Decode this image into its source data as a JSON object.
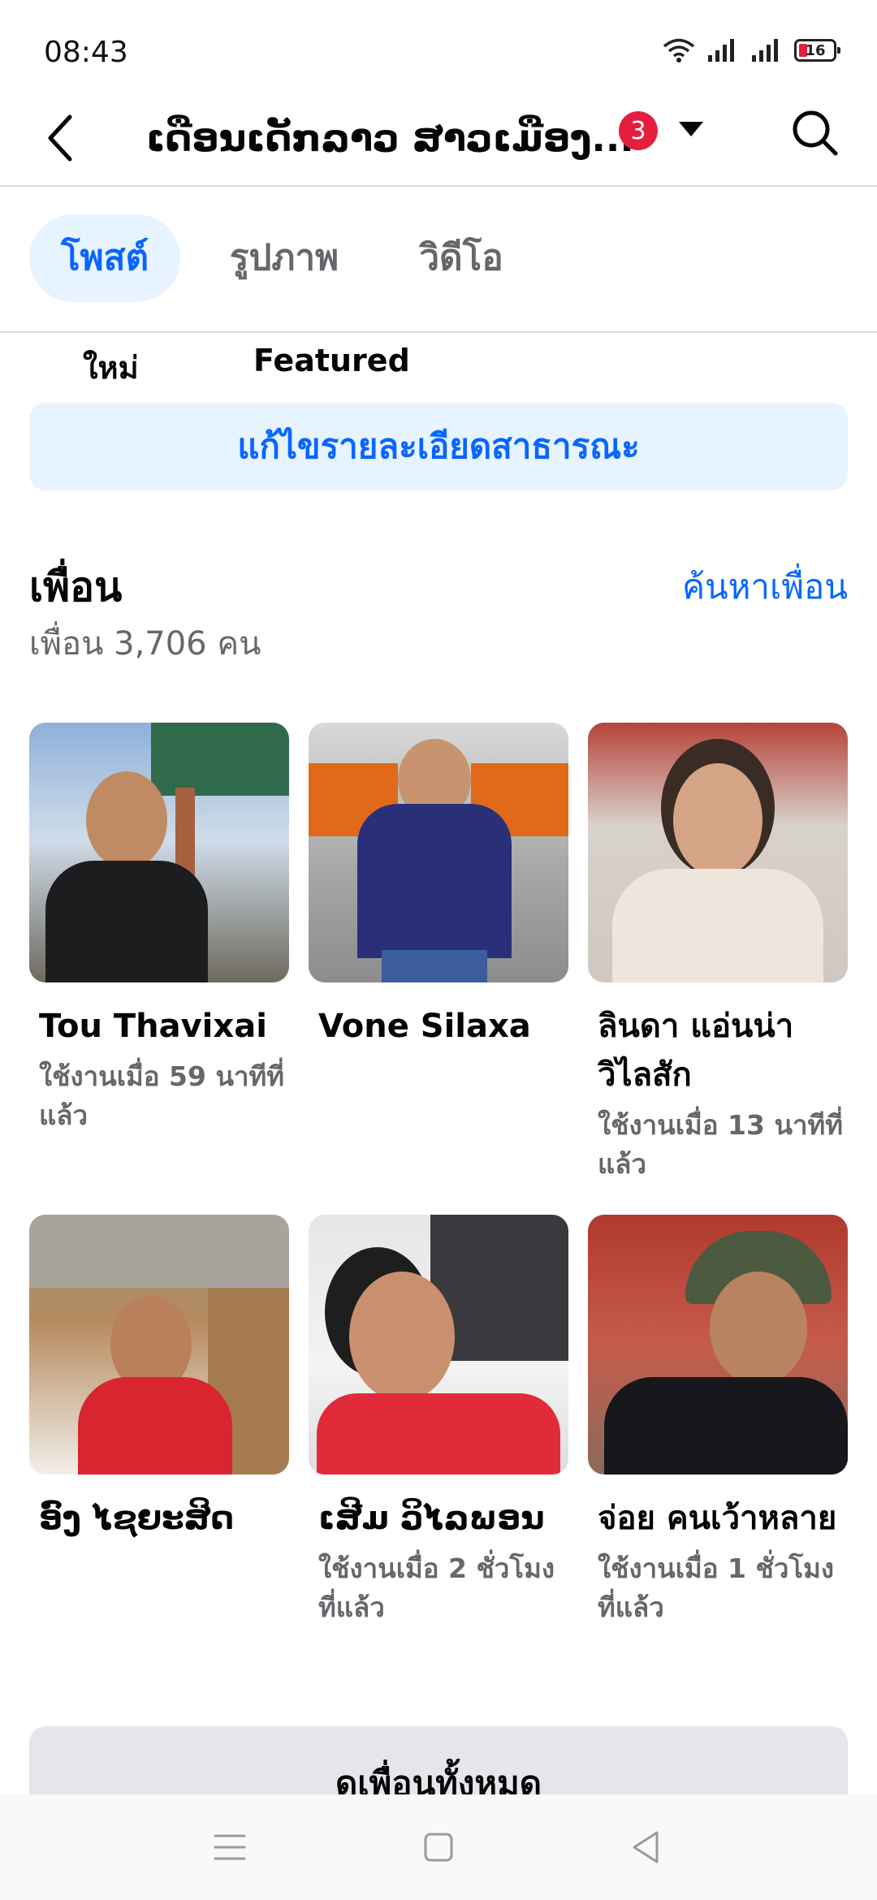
{
  "status_bar": {
    "time": "08:43",
    "battery": "16"
  },
  "header": {
    "title": "ເດືອນເດັກລາວ ສາວເມືອງ...",
    "notification_count": "3"
  },
  "tabs": [
    {
      "label": "โพสต์",
      "active": true
    },
    {
      "label": "รูปภาพ",
      "active": false
    },
    {
      "label": "วิดีโอ",
      "active": false
    }
  ],
  "sub_tabs": [
    {
      "label": "ใหม่"
    },
    {
      "label": "Featured"
    }
  ],
  "edit_public_details": "แก้ไขรายละเอียดสาธารณะ",
  "friends": {
    "title": "เพื่อน",
    "find_friends": "ค้นหาเพื่อน",
    "count": "เพื่อน 3,706 คน",
    "items": [
      {
        "name": "Tou Thavixai",
        "status": "ใช้งานเมื่อ 59 นาทีที่แล้ว"
      },
      {
        "name": "Vone Silaxa",
        "status": ""
      },
      {
        "name": "ลินดา แอ่นน่า วิไลสัก",
        "status": "ใช้งานเมื่อ 13 นาทีที่แล้ว"
      },
      {
        "name": "ອົງ ໄຊຍະສິດ",
        "status": ""
      },
      {
        "name": "ເສີມ ວິໄລພອນ",
        "status": "ใช้งานเมื่อ 2 ชั่วโมงที่แล้ว"
      },
      {
        "name": "จ่อย คนเว้าหลาย",
        "status": "ใช้งานเมื่อ 1 ชั่วโมงที่แล้ว"
      }
    ],
    "see_all": "ดูเพื่อนทั้งหมด"
  },
  "colors": {
    "accent": "#0866ff",
    "accent_bg": "#e7f3ff",
    "badge": "#e41e3f",
    "secondary_text": "#65676b"
  }
}
